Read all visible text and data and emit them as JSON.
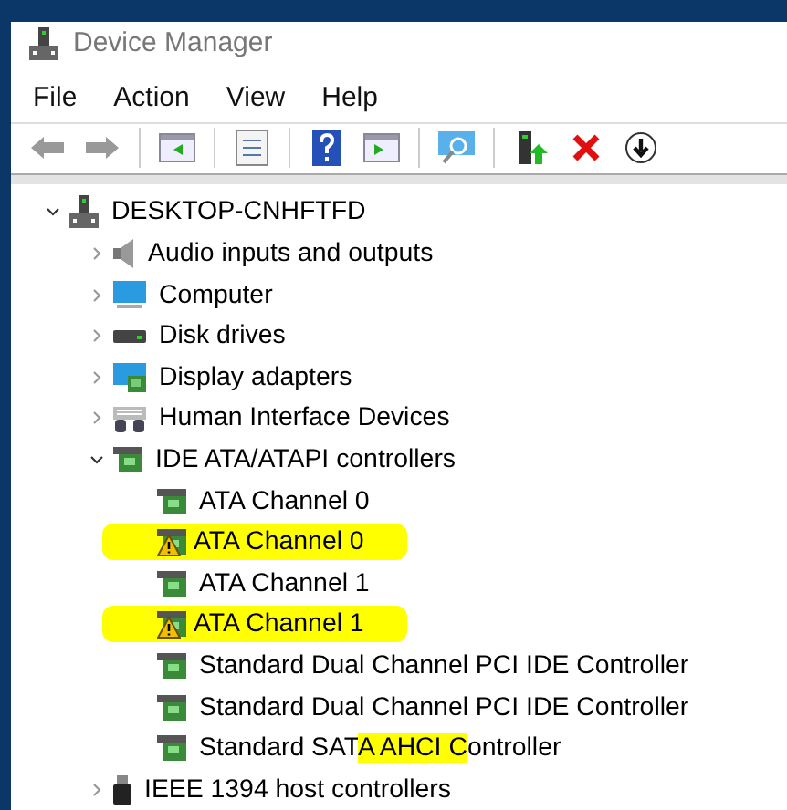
{
  "window": {
    "title": "Device Manager"
  },
  "menu": [
    "File",
    "Action",
    "View",
    "Help"
  ],
  "toolbar": [
    {
      "kind": "back"
    },
    {
      "kind": "forward"
    },
    {
      "kind": "sep"
    },
    {
      "kind": "pane-left"
    },
    {
      "kind": "sep"
    },
    {
      "kind": "properties"
    },
    {
      "kind": "sep"
    },
    {
      "kind": "help"
    },
    {
      "kind": "pane-right"
    },
    {
      "kind": "sep"
    },
    {
      "kind": "scan"
    },
    {
      "kind": "sep"
    },
    {
      "kind": "update"
    },
    {
      "kind": "remove"
    },
    {
      "kind": "install"
    }
  ],
  "tree": [
    {
      "kind": "computer",
      "expanded": true,
      "parts": [
        {
          "text": "DESKTOP-CNHFTFD",
          "highlighted": false
        }
      ],
      "children": [
        {
          "kind": "audio",
          "expanded": false,
          "parts": [
            {
              "text": "Audio inputs and outputs",
              "highlighted": false
            }
          ]
        },
        {
          "kind": "monitor",
          "expanded": false,
          "parts": [
            {
              "text": "Computer",
              "highlighted": false
            }
          ]
        },
        {
          "kind": "disk",
          "expanded": false,
          "parts": [
            {
              "text": "Disk drives",
              "highlighted": false
            }
          ]
        },
        {
          "kind": "display",
          "expanded": false,
          "parts": [
            {
              "text": "Display adapters",
              "highlighted": false
            }
          ]
        },
        {
          "kind": "hid",
          "expanded": false,
          "parts": [
            {
              "text": "Human Interface Devices",
              "highlighted": false
            }
          ]
        },
        {
          "kind": "card",
          "expanded": true,
          "parts": [
            {
              "text": "IDE ATA/ATAPI controllers",
              "highlighted": false
            }
          ],
          "children": [
            {
              "kind": "card",
              "warning": false,
              "parts": [
                {
                  "text": "ATA Channel 0",
                  "highlighted": false
                }
              ]
            },
            {
              "kind": "card",
              "warning": true,
              "parts": [
                {
                  "text": "ATA Channel 0",
                  "highlighted": true
                }
              ]
            },
            {
              "kind": "card",
              "warning": false,
              "parts": [
                {
                  "text": "ATA Channel 1",
                  "highlighted": false
                }
              ]
            },
            {
              "kind": "card",
              "warning": true,
              "parts": [
                {
                  "text": "ATA Channel 1",
                  "highlighted": true
                }
              ]
            },
            {
              "kind": "card",
              "warning": false,
              "parts": [
                {
                  "text": "Standard Dual Channel PCI IDE Controller",
                  "highlighted": false
                }
              ]
            },
            {
              "kind": "card",
              "warning": false,
              "parts": [
                {
                  "text": "Standard Dual Channel PCI IDE Controller",
                  "highlighted": false
                }
              ]
            },
            {
              "kind": "card",
              "warning": false,
              "parts": [
                {
                  "text": "Standard SAT",
                  "highlighted": false
                },
                {
                  "text": "A AHCI C",
                  "highlighted": true
                },
                {
                  "text": "ontroller",
                  "highlighted": false
                }
              ]
            }
          ]
        },
        {
          "kind": "usb",
          "expanded": false,
          "parts": [
            {
              "text": "IEEE 1394 host controllers",
              "highlighted": false
            }
          ]
        }
      ]
    }
  ]
}
